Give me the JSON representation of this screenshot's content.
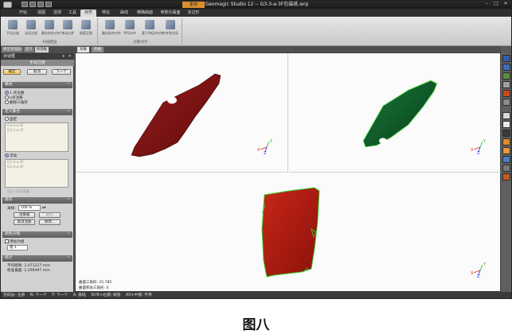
{
  "window": {
    "title": "Geomagic Studio 12 -- G3-3-a-3F包装纸.wrp",
    "context_tab": "素材"
  },
  "menu": {
    "tabs": [
      "开始",
      "视图",
      "选择",
      "工具",
      "对齐",
      "特征",
      "曲线",
      "精确曲面",
      "参数化曲面",
      "多边形"
    ],
    "active_index": 4
  },
  "ribbon": {
    "groups": [
      {
        "title": "扫描配准",
        "buttons": [
          "手动注册",
          "全局注册",
          "最佳拟合对齐",
          "移动边界",
          "赋值至数"
        ]
      },
      {
        "title": "对象对齐",
        "buttons": [
          "最佳拟合对齐",
          "RPS对齐",
          "基于特征的对齐",
          "对齐到全局"
        ]
      }
    ]
  },
  "left_panel": {
    "tabs": [
      "模型管理器",
      "显示",
      "对话框"
    ],
    "header_title": "对话框",
    "sub_title": "手动注册",
    "buttons": {
      "ok": "确定",
      "cancel": "取消",
      "next": "下一个"
    },
    "mode": {
      "title": "模式",
      "options": [
        "1 点注册",
        "n点注册",
        "删除三角形"
      ],
      "selected_index": 0
    },
    "define_set": {
      "title": "定义集合",
      "fixed": {
        "label": "固定",
        "items": [
          "G3-3-a-3F",
          "G3-3-a-3F"
        ]
      },
      "floating": {
        "label": "浮动",
        "items": [
          "G3-3-a-3F",
          "G3-3-a-3F"
        ]
      },
      "footer": "显示   对调   隐藏"
    },
    "operation": {
      "title": "操作",
      "sampling_label": "采样:",
      "sampling_value": "100 %",
      "register_button": "注册器",
      "delete_button": "删除",
      "cancel_register_button": "取消注册",
      "modify_button": "修改..."
    },
    "display_color": {
      "title": "颜色分组",
      "checkbox_label": "添加为组",
      "color_value": "组 1"
    },
    "stats": {
      "title": "统计",
      "avg_distance": "平均距离: 2.071227 mm",
      "std_deviation": "标准偏差: 2.290497 mm"
    }
  },
  "viewport": {
    "tabs": [
      "对象",
      "开始"
    ],
    "active_tab": 0,
    "bottom_info_1": "曲面三角形: 25,785",
    "bottom_info_2": "曲面积总三角形: 0",
    "axis_x": "X",
    "axis_y": "Y",
    "axis_z": "Z",
    "colors": {
      "fixed_object": "#8a1414",
      "floating_object": "#0f5a2a",
      "merged_object": "#b91a12",
      "edge": "#39d435"
    }
  },
  "right_toolbar": {
    "icons": [
      "axis-view-icon",
      "view-front-icon",
      "view-back-icon",
      "shade-icon",
      "wireframe-icon",
      "points-icon",
      "orange-cube-icon",
      "fit-view-icon",
      "rotate-icon",
      "light-icon",
      "hide-icon",
      "color-icon",
      "settings-icon",
      "tool-icon"
    ]
  },
  "statusbar": {
    "items": [
      "完成层: 注册",
      "N: 下一个",
      "F: 下一个",
      "A: 基础",
      "Shift+右键: 缩放",
      "Alt+中键: 平移"
    ]
  },
  "caption": "图八"
}
